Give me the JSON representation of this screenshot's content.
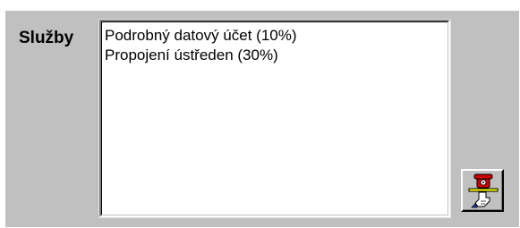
{
  "services": {
    "label": "Služby",
    "items": [
      {
        "label": "Podrobný datový účet (10%)"
      },
      {
        "label": "Propojení ústředen  (30%)"
      }
    ]
  },
  "colors": {
    "panel_background": "#c0c0c0",
    "list_background": "#ffffff",
    "phone_red": "#cc0000",
    "tray_yellow": "#ffff00"
  },
  "phone_button": {
    "icon": "phone-on-tray-icon"
  }
}
